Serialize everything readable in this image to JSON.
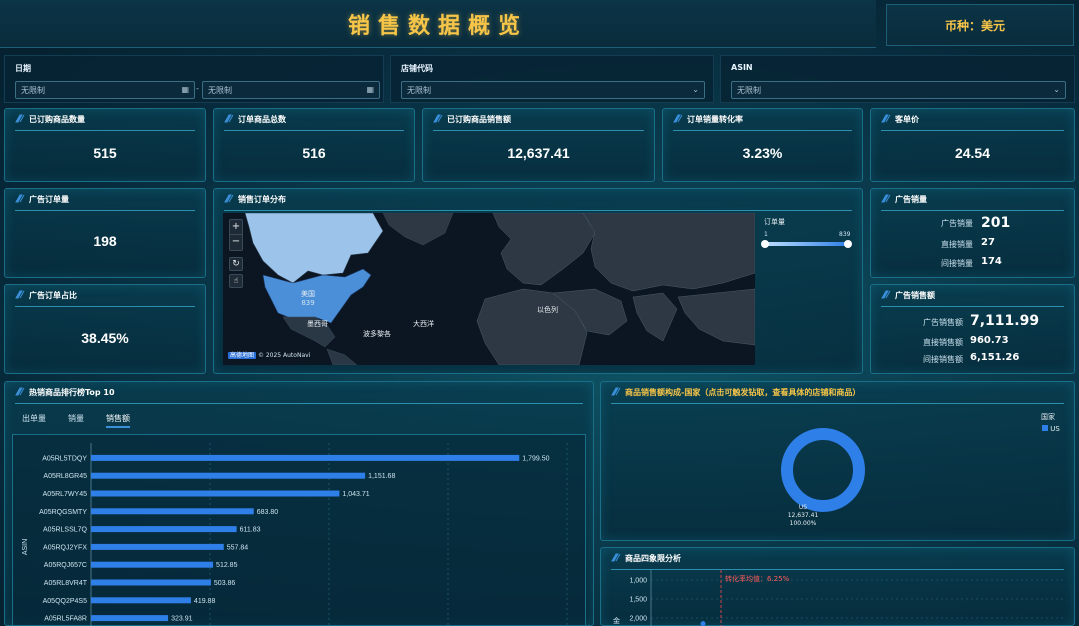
{
  "header": {
    "title": "销售数据概览",
    "currency": "币种：美元"
  },
  "filters": {
    "date_label": "日期",
    "date_start": "无限制",
    "date_end": "无限制",
    "date_sep": "-",
    "store_label": "店铺代码",
    "store_value": "无限制",
    "asin_label": "ASIN",
    "asin_value": "无限制"
  },
  "kpis": [
    {
      "label": "已订购商品数量",
      "value": "515"
    },
    {
      "label": "订单商品总数",
      "value": "516"
    },
    {
      "label": "已订购商品销售额",
      "value": "12,637.41"
    },
    {
      "label": "订单销量转化率",
      "value": "3.23%"
    },
    {
      "label": "客单价",
      "value": "24.54"
    }
  ],
  "ad_orders": {
    "label": "广告订单量",
    "value": "198"
  },
  "ad_order_ratio": {
    "label": "广告订单占比",
    "value": "38.45%"
  },
  "map": {
    "title": "销售订单分布",
    "legend_title": "订单量",
    "legend_min": "1",
    "legend_max": "839",
    "us_label": "美国",
    "us_value": "839",
    "mexico_label": "墨西哥",
    "caribbean_label": "波多黎各",
    "atlantic_label": "大西洋",
    "israel_label": "以色列",
    "attribution": "© 2025 AutoNavi",
    "logo_text": "高德地图",
    "zoom_in": "+",
    "zoom_out": "−",
    "reset": "↻",
    "locate": "☝"
  },
  "ad_sales_qty": {
    "title": "广告销量",
    "rows": [
      {
        "label": "广告销量",
        "value": "201"
      },
      {
        "label": "直接销量",
        "value": "27"
      },
      {
        "label": "间接销量",
        "value": "174"
      }
    ]
  },
  "ad_sales_amt": {
    "title": "广告销售额",
    "rows": [
      {
        "label": "广告销售额",
        "value": "7,111.99"
      },
      {
        "label": "直接销售额",
        "value": "960.73"
      },
      {
        "label": "间接销售额",
        "value": "6,151.26"
      }
    ]
  },
  "top10": {
    "title": "热销商品排行榜Top 10",
    "tabs": [
      "出单量",
      "销量",
      "销售额"
    ],
    "active_tab": 2,
    "axis_label": "ASIN"
  },
  "country_panel": {
    "title": "商品销售额构成-国家（点击可触发钻取，查看具体的店铺和商品）",
    "legend_title": "国家",
    "legend_item": "US",
    "slice_label": "US",
    "slice_value": "12,637.41",
    "slice_percent": "100.00%"
  },
  "quadrant": {
    "title": "商品四象限分析",
    "avg_label": "转化率均值：6.25%",
    "y_ticks": [
      "2,000",
      "1,500",
      "1,000"
    ],
    "y_axis_label": "金"
  },
  "colors": {
    "accent": "#3a8fd8",
    "gold": "#f7c548",
    "bar": "#2f7fe8",
    "us_fill": "#4a8fd8"
  },
  "chart_data": [
    {
      "type": "bar",
      "orientation": "horizontal",
      "title": "",
      "ylabel": "ASIN",
      "categories": [
        "A05RL5TDQY",
        "A05RL8GR45",
        "A05RL7WY45",
        "A05RQGSMTY",
        "A05RLSSL7Q",
        "A05RQJ2YFX",
        "A05RQJ657C",
        "A05RL8VR4T",
        "A05QQ2P4S5",
        "A05RL5FA8R"
      ],
      "values": [
        1799.5,
        1151.68,
        1043.71,
        683.8,
        611.83,
        557.84,
        512.85,
        503.86,
        419.88,
        323.91
      ],
      "value_labels": [
        "1,799.50",
        "1,151.68",
        "1,043.71",
        "683.80",
        "611.83",
        "557.84",
        "512.85",
        "503.86",
        "419.88",
        "323.91"
      ],
      "xlim": [
        0,
        2000
      ]
    },
    {
      "type": "pie",
      "title": "",
      "legend_title": "国家",
      "categories": [
        "US"
      ],
      "values": [
        12637.41
      ],
      "percent": [
        100.0
      ]
    },
    {
      "type": "scatter",
      "title": "",
      "ylim": [
        0,
        2000
      ],
      "yticks": [
        1000,
        1500,
        2000
      ],
      "annotation": "转化率均值：6.25%",
      "points": [
        {
          "y": 800
        }
      ]
    }
  ]
}
